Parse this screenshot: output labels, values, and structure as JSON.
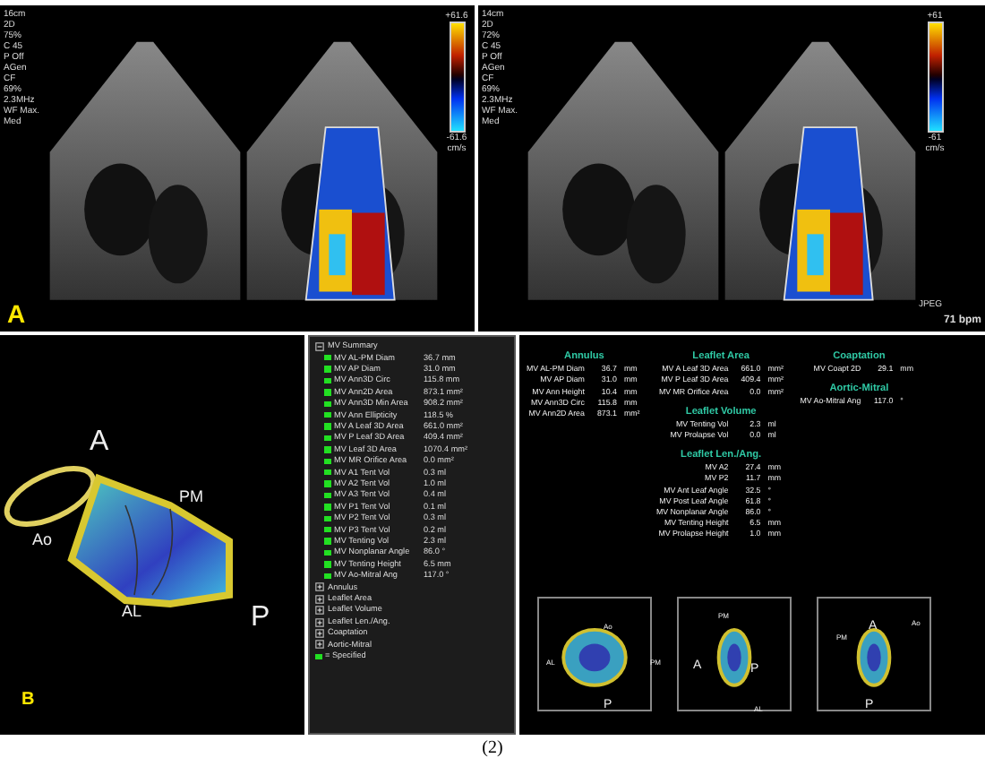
{
  "panel_a": {
    "label": "A",
    "depth": "16cm",
    "settings": [
      "2D",
      "75%",
      "C 45",
      "P Off",
      "AGen",
      "CF",
      "69%",
      "2.3MHz",
      "WF Max.",
      "Med"
    ],
    "scale_max": "+61.6",
    "scale_min": "-61.6",
    "scale_unit": "cm/s"
  },
  "panel_echo_right": {
    "depth": "14cm",
    "settings": [
      "2D",
      "72%",
      "C 45",
      "P Off",
      "AGen",
      "CF",
      "69%",
      "2.3MHz",
      "WF Max.",
      "Med"
    ],
    "scale_max": "+61",
    "scale_min": "-61",
    "scale_unit": "cm/s",
    "format": "JPEG",
    "heart_rate": "71 bpm"
  },
  "panel_b": {
    "label": "B",
    "model_labels": [
      "A",
      "PM",
      "Ao",
      "AL",
      "P"
    ]
  },
  "tree": [
    {
      "label": "MV Summary",
      "expanded": true,
      "children": [
        {
          "label": "MV AL-PM Diam",
          "value": "36.7 mm"
        },
        {
          "label": "MV AP Diam",
          "value": "31.0 mm"
        },
        {
          "label": "MV Ann3D Circ",
          "value": "115.8 mm"
        },
        {
          "label": "MV Ann2D Area",
          "value": "873.1 mm²"
        },
        {
          "label": "MV Ann3D Min Area",
          "value": "908.2 mm²"
        },
        {
          "label": "MV Ann Ellipticity",
          "value": "118.5 %"
        },
        {
          "label": "MV A Leaf 3D Area",
          "value": "661.0 mm²"
        },
        {
          "label": "MV P Leaf 3D Area",
          "value": "409.4 mm²"
        },
        {
          "label": "MV Leaf 3D Area",
          "value": "1070.4 mm²"
        },
        {
          "label": "MV MR Orifice Area",
          "value": "0.0 mm²"
        },
        {
          "label": "MV A1 Tent Vol",
          "value": "0.3 ml"
        },
        {
          "label": "MV A2 Tent Vol",
          "value": "1.0 ml"
        },
        {
          "label": "MV A3 Tent Vol",
          "value": "0.4 ml"
        },
        {
          "label": "MV P1 Tent Vol",
          "value": "0.1 ml"
        },
        {
          "label": "MV P2 Tent Vol",
          "value": "0.3 ml"
        },
        {
          "label": "MV P3 Tent Vol",
          "value": "0.2 ml"
        },
        {
          "label": "MV Tenting Vol",
          "value": "2.3 ml"
        },
        {
          "label": "MV Nonplanar Angle",
          "value": "86.0 °"
        },
        {
          "label": "MV Tenting Height",
          "value": "6.5 mm"
        },
        {
          "label": "MV Ao-Mitral Ang",
          "value": "117.0 °"
        }
      ]
    },
    {
      "label": "Annulus",
      "expanded": false
    },
    {
      "label": "Leaflet Area",
      "expanded": false
    },
    {
      "label": "Leaflet Volume",
      "expanded": false
    },
    {
      "label": "Leaflet Len./Ang.",
      "expanded": false
    },
    {
      "label": "Coaptation",
      "expanded": false
    },
    {
      "label": "Aortic-Mitral",
      "expanded": false
    }
  ],
  "legend": "= Specified",
  "results": [
    {
      "sections": [
        {
          "title": "Annulus",
          "rows": [
            {
              "name": "MV AL-PM Diam",
              "value": "36.7",
              "unit": "mm"
            },
            {
              "name": "MV AP Diam",
              "value": "31.0",
              "unit": "mm"
            },
            {
              "name": "MV Ann Height",
              "value": "10.4",
              "unit": "mm"
            },
            {
              "name": "MV Ann3D Circ",
              "value": "115.8",
              "unit": "mm"
            },
            {
              "name": "MV Ann2D Area",
              "value": "873.1",
              "unit": "mm²"
            }
          ]
        }
      ]
    },
    {
      "sections": [
        {
          "title": "Leaflet Area",
          "rows": [
            {
              "name": "MV A Leaf 3D Area",
              "value": "661.0",
              "unit": "mm²"
            },
            {
              "name": "MV P Leaf 3D Area",
              "value": "409.4",
              "unit": "mm²"
            },
            {
              "name": "MV MR Orifice Area",
              "value": "0.0",
              "unit": "mm²"
            }
          ]
        },
        {
          "title": "Leaflet Volume",
          "rows": [
            {
              "name": "MV Tenting Vol",
              "value": "2.3",
              "unit": "ml"
            },
            {
              "name": "MV Prolapse Vol",
              "value": "0.0",
              "unit": "ml"
            }
          ]
        },
        {
          "title": "Leaflet Len./Ang.",
          "rows": [
            {
              "name": "MV A2",
              "value": "27.4",
              "unit": "mm"
            },
            {
              "name": "MV P2",
              "value": "11.7",
              "unit": "mm"
            },
            {
              "name": "MV Ant Leaf Angle",
              "value": "32.5",
              "unit": "°"
            },
            {
              "name": "MV Post Leaf Angle",
              "value": "61.8",
              "unit": "°"
            },
            {
              "name": "MV Nonplanar Angle",
              "value": "86.0",
              "unit": "°"
            },
            {
              "name": "MV Tenting Height",
              "value": "6.5",
              "unit": "mm"
            },
            {
              "name": "MV Prolapse Height",
              "value": "1.0",
              "unit": "mm"
            }
          ]
        }
      ]
    },
    {
      "sections": [
        {
          "title": "Coaptation",
          "rows": [
            {
              "name": "MV Coapt 2D",
              "value": "29.1",
              "unit": "mm"
            }
          ]
        },
        {
          "title": "Aortic-Mitral",
          "rows": [
            {
              "name": "MV Ao-Mitral Ang",
              "value": "117.0",
              "unit": "°"
            }
          ]
        }
      ]
    }
  ],
  "thumbnails": [
    {
      "labels": [
        "Ao",
        "AL",
        "PM",
        "P"
      ]
    },
    {
      "labels": [
        "PM",
        "A",
        "P",
        "AL"
      ]
    },
    {
      "labels": [
        "A",
        "Ao",
        "PM",
        "P"
      ]
    }
  ],
  "caption": "(2)"
}
